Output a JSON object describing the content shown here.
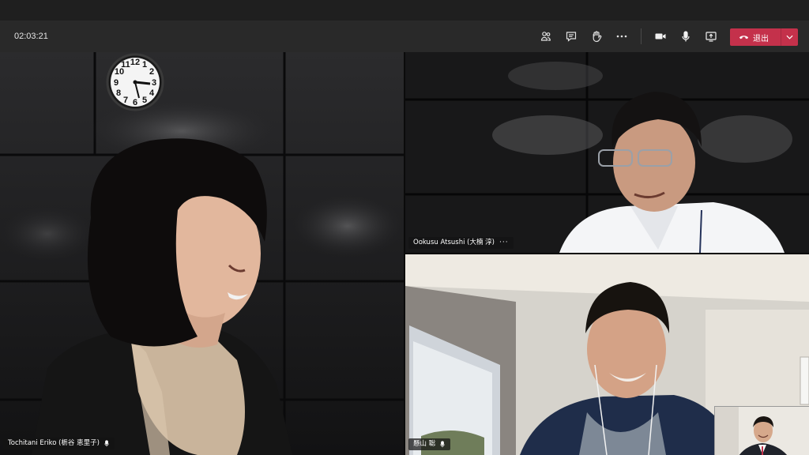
{
  "toolbar": {
    "timer": "02:03:21",
    "icons": [
      "participants-icon",
      "chat-icon",
      "raise-hand-icon",
      "more-icon",
      "camera-icon",
      "microphone-icon",
      "share-screen-icon"
    ],
    "leave_label": "退出",
    "leave_color": "#c4314b"
  },
  "participants": [
    {
      "name": "Tochitani Eriko (栃谷 恵里子)"
    },
    {
      "name": "Ookusu Atsushi (大楠 淳)",
      "more": "···"
    },
    {
      "name": "懸山 聡"
    }
  ],
  "clock": {
    "numbers": [
      "12",
      "1",
      "2",
      "3",
      "4",
      "5",
      "6",
      "7",
      "8",
      "9",
      "10",
      "11"
    ]
  }
}
